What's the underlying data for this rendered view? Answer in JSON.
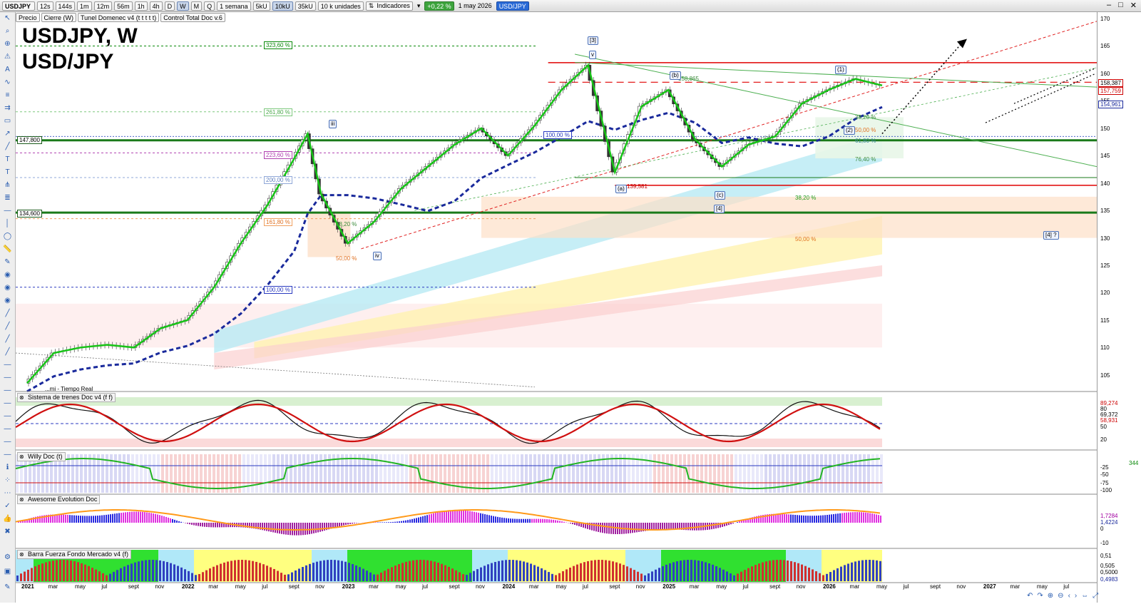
{
  "toolbar": {
    "symbol": "USDJPY",
    "timeframes": [
      "12s",
      "144s",
      "1m",
      "12m",
      "56m",
      "1h",
      "4h",
      "D",
      "W",
      "M",
      "Q"
    ],
    "active_timeframe": "W",
    "period": "1 semana",
    "units_a": "5kU",
    "units_b": "10kU",
    "units_c": "35kU",
    "units_d": "10 k unidades",
    "indicators": "Indicadores",
    "change": "+0,22 %",
    "date": "1 may 2026",
    "ticker": "USD/JPY"
  },
  "overlays": {
    "price": "Precio",
    "close": "Cierre (W)",
    "tunnel": "Tunel Domenec v4 (t t t t t)",
    "control": "Control Total Doc v.6"
  },
  "title_line1": "USDJPY, W",
  "title_line2": "USD/JPY",
  "realtime_note": "...mi - Tiempo Real",
  "panels": {
    "p1": "Sistema de trenes Doc v4 (f f)",
    "p2": "Willy Doc (t)",
    "p3": "Awesome Evolution Doc",
    "p4": "Barra Fuerza Fondo Mercado v4 (f)"
  },
  "y_axis_main": [
    "170",
    "165",
    "160",
    "155",
    "150",
    "145",
    "140",
    "135",
    "130",
    "125",
    "120",
    "115",
    "110",
    "105"
  ],
  "price_tags": {
    "a": "158,387",
    "b": "157,759",
    "c": "154,961"
  },
  "left_levels": {
    "l1": "147,800",
    "l2": "134,600"
  },
  "fib_levels": {
    "f1": "323,60 %",
    "f2": "261,80 %",
    "f3": "223,60 %",
    "f4": "200,00 %",
    "f5": "161,80 %",
    "f6": "100,00 %",
    "f7": "100,00 %",
    "f8": "50,00 %",
    "f9": "38,20 %",
    "f10": "50,00 %",
    "f11": "61,80 %",
    "f12": "76,40 %",
    "f13": "38,20 %",
    "f14": "50,00 %",
    "f15": "38,20 %"
  },
  "price_notes": {
    "n1": "139,581",
    "n2": "158,865"
  },
  "waves": {
    "w1": "[3]",
    "w2": "v",
    "w3": "iii",
    "w4": "iv",
    "w5": "(a)",
    "w6": "(b)",
    "w7": "(c)",
    "w8": "[4]",
    "w9": "(1)",
    "w10": "(2)",
    "w11": "[4] ?"
  },
  "panel_values": {
    "p1": [
      "89,274",
      "80",
      "69,372",
      "58,931",
      "50",
      "20"
    ],
    "p2": [
      "-25",
      "-50",
      "-75",
      "-100",
      "344"
    ],
    "p3": [
      "1,7284",
      "1,4224",
      "0",
      "-10"
    ],
    "p4": [
      "0,51",
      "0,505",
      "0,5000",
      "0,4983"
    ]
  },
  "x_axis": [
    "2021",
    "mar",
    "may",
    "jul",
    "sept",
    "nov",
    "2022",
    "mar",
    "may",
    "jul",
    "sept",
    "nov",
    "2023",
    "mar",
    "may",
    "jul",
    "sept",
    "nov",
    "2024",
    "mar",
    "may",
    "jul",
    "sept",
    "nov",
    "2025",
    "mar",
    "may",
    "jul",
    "sept",
    "nov",
    "2026",
    "mar",
    "may",
    "jul",
    "sept",
    "nov",
    "2027",
    "mar",
    "may",
    "jul"
  ],
  "colors": {
    "bull": "#00b400",
    "bear": "#e00000",
    "fastline": "#17c417",
    "slowline": "#1a2a9c",
    "resistance": "#e00000",
    "support": "#1a7a1a"
  },
  "chart_data": {
    "type": "line",
    "title": "USDJPY, W",
    "subtitle": "USD/JPY",
    "x": [
      "2021-01",
      "2021-03",
      "2021-05",
      "2021-07",
      "2021-09",
      "2021-11",
      "2022-01",
      "2022-03",
      "2022-05",
      "2022-07",
      "2022-09",
      "2022-10",
      "2022-11",
      "2023-01",
      "2023-03",
      "2023-05",
      "2023-07",
      "2023-09",
      "2023-11",
      "2024-01",
      "2024-03",
      "2024-05",
      "2024-07",
      "2024-09",
      "2024-11",
      "2025-01",
      "2025-03",
      "2025-05",
      "2025-07",
      "2025-09",
      "2025-11",
      "2026-01",
      "2026-03",
      "2026-05"
    ],
    "series": [
      {
        "values": [
          103.5,
          109,
          110,
          110.5,
          110,
          113.5,
          115,
          121,
          129,
          136,
          144.5,
          149,
          138,
          129,
          133,
          139,
          143,
          147,
          150,
          145,
          150.5,
          157,
          161.5,
          142,
          154,
          157,
          148,
          143,
          147,
          148.5,
          154.5,
          157,
          159,
          157.8
        ]
      }
    ],
    "ylim": [
      100,
      170
    ],
    "y_ticks": [
      105,
      110,
      115,
      120,
      125,
      130,
      135,
      140,
      145,
      150,
      155,
      160,
      165,
      170
    ],
    "horizontal_levels": [
      161.95,
      158.387,
      157.759,
      147.8,
      141.0,
      139.581,
      134.6
    ],
    "grid": false
  }
}
